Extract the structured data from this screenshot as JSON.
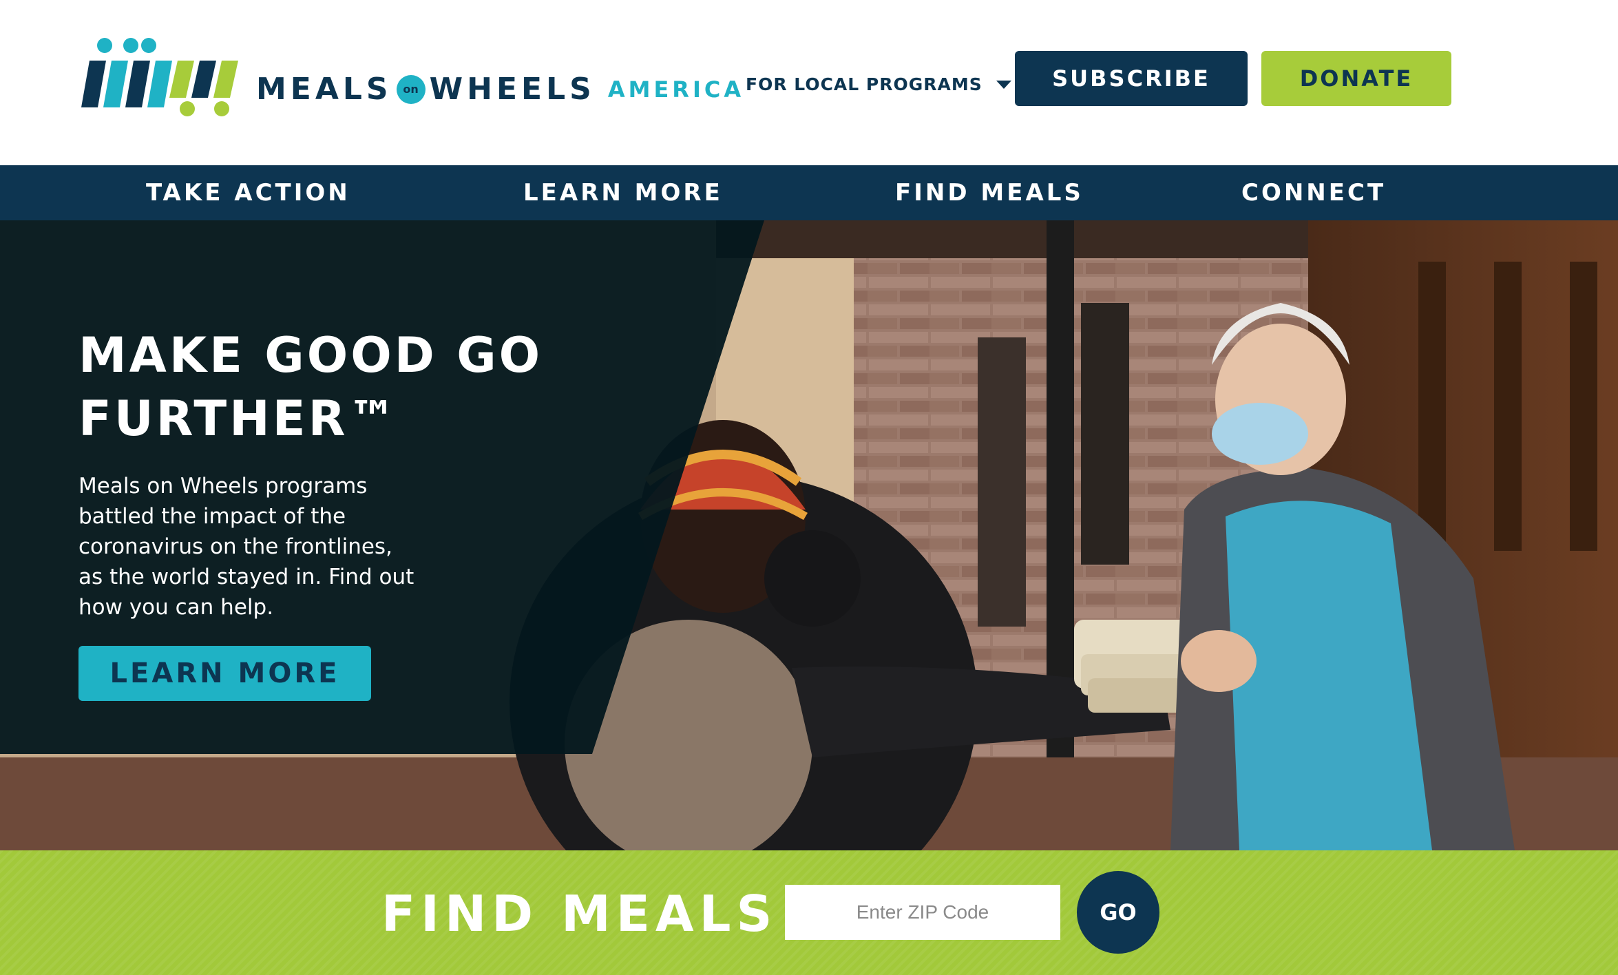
{
  "brand": {
    "name_meals": "MEALS",
    "name_on": "on",
    "name_wheels": "WHEELS",
    "name_america": "AMERICA",
    "colors": {
      "navy": "#0d3551",
      "teal": "#1fb2c5",
      "green": "#a7cc3a"
    }
  },
  "header": {
    "local_programs": "FOR LOCAL PROGRAMS",
    "subscribe": "SUBSCRIBE",
    "donate": "DONATE"
  },
  "nav": {
    "items": [
      {
        "label": "TAKE ACTION"
      },
      {
        "label": "LEARN MORE"
      },
      {
        "label": "FIND MEALS"
      },
      {
        "label": "CONNECT"
      }
    ]
  },
  "hero": {
    "title_line1": "MAKE GOOD GO",
    "title_line2": "FURTHER™",
    "body": "Meals on Wheels programs battled the impact of the coronavirus on the frontlines, as the world stayed in. Find out how you can help.",
    "cta": "LEARN MORE"
  },
  "find_meals": {
    "title": "FIND MEALS",
    "zip_placeholder": "Enter ZIP Code",
    "go": "GO"
  }
}
